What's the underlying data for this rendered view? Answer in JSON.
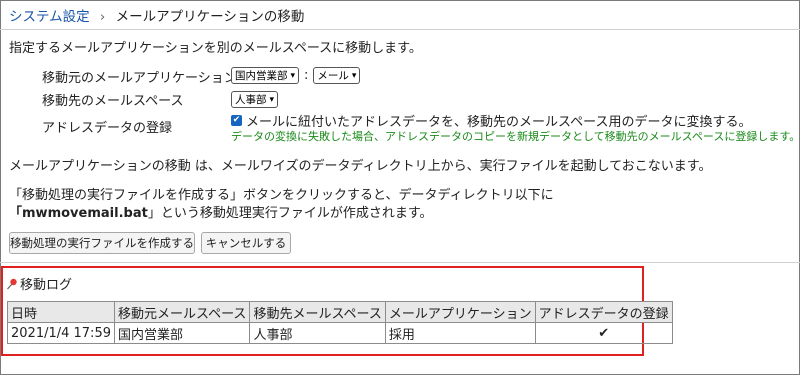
{
  "breadcrumb": {
    "parent": "システム設定",
    "separator": "›",
    "current": "メールアプリケーションの移動"
  },
  "intro": "指定するメールアプリケーションを別のメールスペースに移動します。",
  "form": {
    "source_label": "移動元のメールアプリケーション",
    "source_space": "国内営業部",
    "colon": ":",
    "source_app": "メール",
    "dest_label": "移動先のメールスペース",
    "dest_space": "人事部",
    "address_label": "アドレスデータの登録",
    "address_checkbox_label": "メールに紐付いたアドレスデータを、移動先のメールスペース用のデータに変換する。",
    "address_checked": true,
    "address_note": "データの変換に失敗した場合、アドレスデータのコピーを新規データとして移動先のメールスペースに登録します。"
  },
  "description": {
    "line1": "メールアプリケーションの移動 は、メールワイズのデータディレクトリ上から、実行ファイルを起動しておこないます。",
    "line2": "「移動処理の実行ファイルを作成する」ボタンをクリックすると、データディレクトリ以下に",
    "line3_open": "「",
    "filename": "mwmovemail.bat",
    "line3_rest": "」という移動処理実行ファイルが作成されます。"
  },
  "buttons": {
    "create": "移動処理の実行ファイルを作成する",
    "cancel": "キャンセルする"
  },
  "log": {
    "title": "移動ログ",
    "columns": [
      "日時",
      "移動元メールスペース",
      "移動先メールスペース",
      "メールアプリケーション",
      "アドレスデータの登録"
    ],
    "rows": [
      {
        "datetime": "2021/1/4 17:59",
        "source": "国内営業部",
        "dest": "人事部",
        "app": "採用",
        "address": "✔"
      }
    ]
  }
}
